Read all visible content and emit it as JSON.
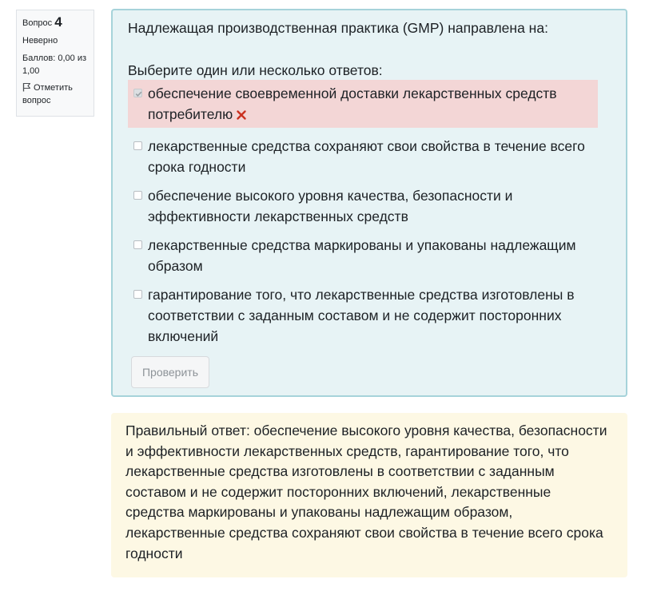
{
  "info": {
    "question_label": "Вопрос",
    "question_number": "4",
    "state": "Неверно",
    "grade": "Баллов: 0,00 из 1,00",
    "flag_label": "Отметить вопрос",
    "flag_icon": "flag-icon"
  },
  "question": {
    "text": "Надлежащая производственная практика (GMP) направлена на:",
    "prompt": "Выберите один или несколько ответов:",
    "options": [
      {
        "label": "обеспечение своевременной доставки лекарственных средств потребителю",
        "checked": true,
        "status": "incorrect"
      },
      {
        "label": "лекарственные средства сохраняют свои свойства в течение всего срока годности",
        "checked": false
      },
      {
        "label": "обеспечение высокого уровня качества, безопасности и эффективности лекарственных средств",
        "checked": false
      },
      {
        "label": "лекарственные средства маркированы и упакованы надлежащим образом",
        "checked": false
      },
      {
        "label": "гарантирование того, что лекарственные средства изготовлены в соответствии с заданным составом и не содержит посторонних включений",
        "checked": false
      }
    ],
    "check_button": "Проверить"
  },
  "feedback": {
    "right_answer": "Правильный ответ: обеспечение высокого уровня качества, безопасности и эффективности лекарственных средств, гарантирование того, что лекарственные средства изготовлены в соответствии с заданным составом и не содержит посторонних включений, лекарственные средства маркированы и упакованы надлежащим образом, лекарственные средства сохраняют свои свойства в течение всего срока годности"
  },
  "colors": {
    "question_bg": "#e7f3f5",
    "question_border": "#a6d3da",
    "incorrect_bg": "#f3d6d6",
    "incorrect_mark": "#ca3120",
    "feedback_bg": "#fdf8e4"
  }
}
